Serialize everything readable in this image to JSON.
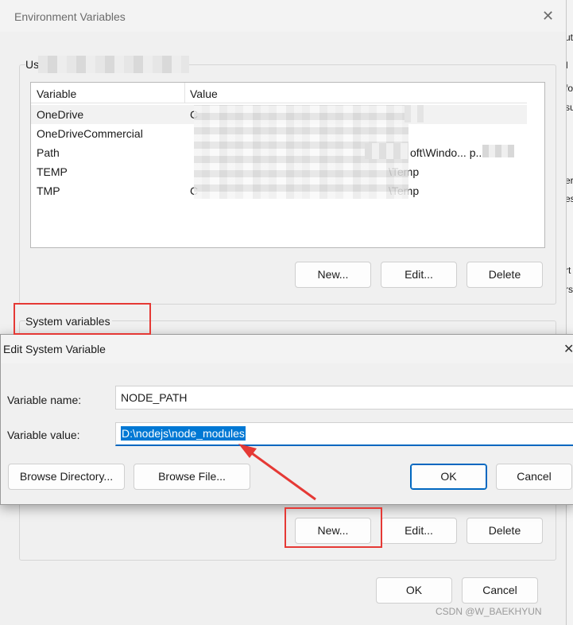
{
  "env_dialog": {
    "title": "Environment Variables",
    "user_group_label": "Us",
    "table": {
      "columns": [
        "Variable",
        "Value"
      ],
      "rows": [
        {
          "variable": "OneDrive",
          "value": "C",
          "value_tail": "t"
        },
        {
          "variable": "OneDriveCommercial",
          "value": "",
          "value_tail": ""
        },
        {
          "variable": "Path",
          "value": "",
          "value_tail": "oft\\Windo... p..."
        },
        {
          "variable": "TEMP",
          "value": "",
          "value_tail": "\\Temp"
        },
        {
          "variable": "TMP",
          "value": "C",
          "value_tail": "\\Temp"
        }
      ]
    },
    "user_buttons": {
      "new": "New...",
      "edit": "Edit...",
      "delete": "Delete"
    },
    "system_group_label": "System variables",
    "system_buttons": {
      "new": "New...",
      "edit": "Edit...",
      "delete": "Delete"
    },
    "footer_buttons": {
      "ok": "OK",
      "cancel": "Cancel"
    }
  },
  "edit_dialog": {
    "title": "Edit System Variable",
    "name_label": "Variable name:",
    "name_value": "NODE_PATH",
    "value_label": "Variable value:",
    "value_value": "D:\\nodejs\\node_modules",
    "browse_directory": "Browse Directory...",
    "browse_file": "Browse File...",
    "ok": "OK",
    "cancel": "Cancel"
  },
  "right_edge_fragments": [
    "ut",
    "l",
    "fo",
    "su",
    "er",
    "es",
    "rt",
    "rs"
  ],
  "watermark": "CSDN @W_BAEKHYUN",
  "colors": {
    "annotation_red": "#e53935",
    "selection_blue": "#0078d4",
    "accent": "#0067c0"
  }
}
